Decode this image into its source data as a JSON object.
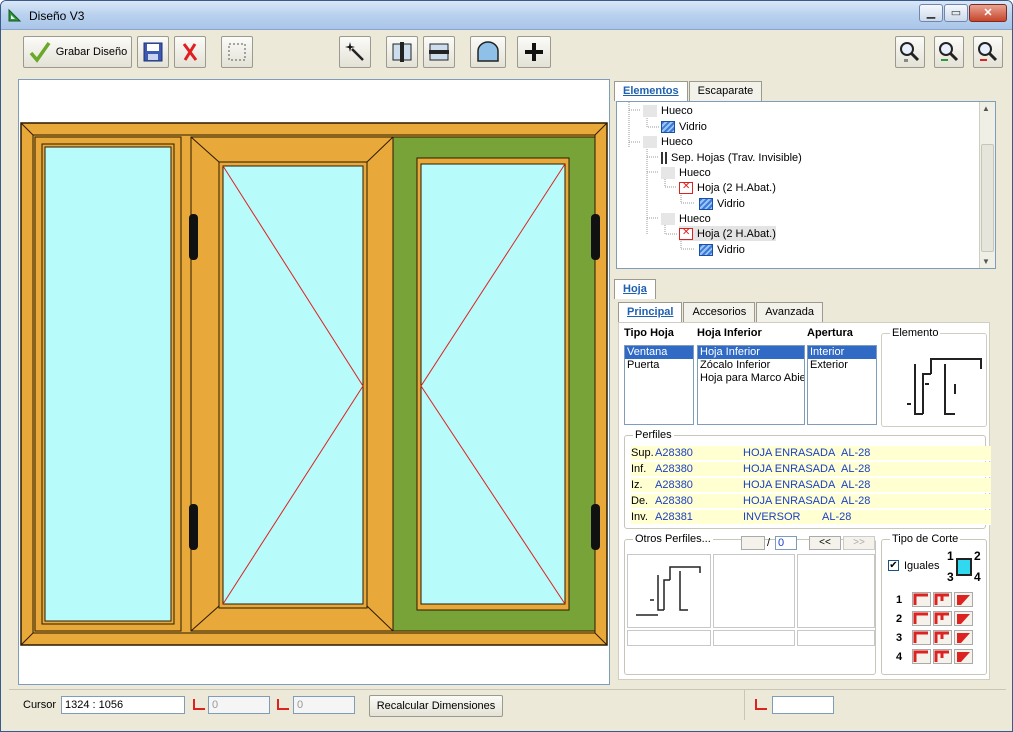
{
  "window": {
    "title": "Diseño V3",
    "min": "▁",
    "max": "▭",
    "close": "✕"
  },
  "toolbar": {
    "save_design_label": "Grabar Diseño",
    "icons": [
      "check-icon",
      "disk-save-icon",
      "red-x-icon",
      "dotted-select-icon",
      "magic-wand-icon",
      "vertical-split-icon",
      "horizontal-split-icon",
      "arch-icon",
      "plus-icon",
      "zoom-in-icon",
      "zoom-fit-icon",
      "zoom-out-icon"
    ]
  },
  "tree_tabs": {
    "elementos": "Elementos",
    "escaparate": "Escaparate"
  },
  "tree": [
    {
      "label": "Hueco",
      "icon": "hueco"
    },
    {
      "label": "Vidrio",
      "icon": "vidrio"
    },
    {
      "label": "Hueco",
      "icon": "hueco"
    },
    {
      "label": "Sep. Hojas (Trav. Invisible)",
      "icon": "sep"
    },
    {
      "label": "Hueco",
      "icon": "hueco"
    },
    {
      "label": "Hoja (2 H.Abat.)",
      "icon": "hoja"
    },
    {
      "label": "Vidrio",
      "icon": "vidrio"
    },
    {
      "label": "Hueco",
      "icon": "hueco"
    },
    {
      "label": "Hoja (2 H.Abat.)",
      "icon": "hoja"
    },
    {
      "label": "Vidrio",
      "icon": "vidrio"
    }
  ],
  "hoja": {
    "section_tab": "Hoja",
    "tabs": {
      "principal": "Principal",
      "accesorios": "Accesorios",
      "avanzada": "Avanzada"
    },
    "tipo_hoja": {
      "header": "Tipo Hoja",
      "options": [
        "Ventana",
        "Puerta"
      ],
      "selected": "Ventana"
    },
    "hoja_inferior": {
      "header": "Hoja Inferior",
      "options": [
        "Hoja Inferior",
        "Zócalo Inferior",
        "Hoja para Marco Abier"
      ],
      "selected": "Hoja Inferior"
    },
    "apertura": {
      "header": "Apertura",
      "options": [
        "Interior",
        "Exterior"
      ],
      "selected": "Interior"
    },
    "elemento_label": "Elemento",
    "perfiles": {
      "label": "Perfiles",
      "rows": [
        {
          "pos": "Sup.",
          "code": "A28380",
          "desc": "HOJA ENRASADA",
          "series": "AL-28"
        },
        {
          "pos": "Inf.",
          "code": "A28380",
          "desc": "HOJA ENRASADA",
          "series": "AL-28"
        },
        {
          "pos": "Iz.",
          "code": "A28380",
          "desc": "HOJA ENRASADA",
          "series": "AL-28"
        },
        {
          "pos": "De.",
          "code": "A28380",
          "desc": "HOJA ENRASADA",
          "series": "AL-28"
        },
        {
          "pos": "Inv.",
          "code": "A28381",
          "desc": "INVERSOR",
          "series": "AL-28"
        }
      ]
    },
    "otros_perfiles": {
      "label": "Otros Perfiles...",
      "page_of": "/",
      "page_value": "0",
      "prev": "<<",
      "next": ">>"
    },
    "tipo_corte": {
      "label": "Tipo de Corte",
      "iguales": "Iguales",
      "iguales_checked": true,
      "corners": [
        "1",
        "2",
        "3",
        "4"
      ],
      "rows": [
        "1",
        "2",
        "3",
        "4"
      ]
    }
  },
  "statusbar": {
    "cursor_label": "Cursor",
    "cursor_value": "1324 : 1056",
    "dim1_value": "0",
    "dim2_value": "0",
    "recalc_label": "Recalcular Dimensiones",
    "dim3_value": ""
  },
  "colors": {
    "frame": "#e8a93a",
    "glass": "#b8fbfb",
    "selected_sash": "#78a338",
    "accent": "#316ac5",
    "handle": "#111111",
    "diagonal": "#e02020"
  }
}
